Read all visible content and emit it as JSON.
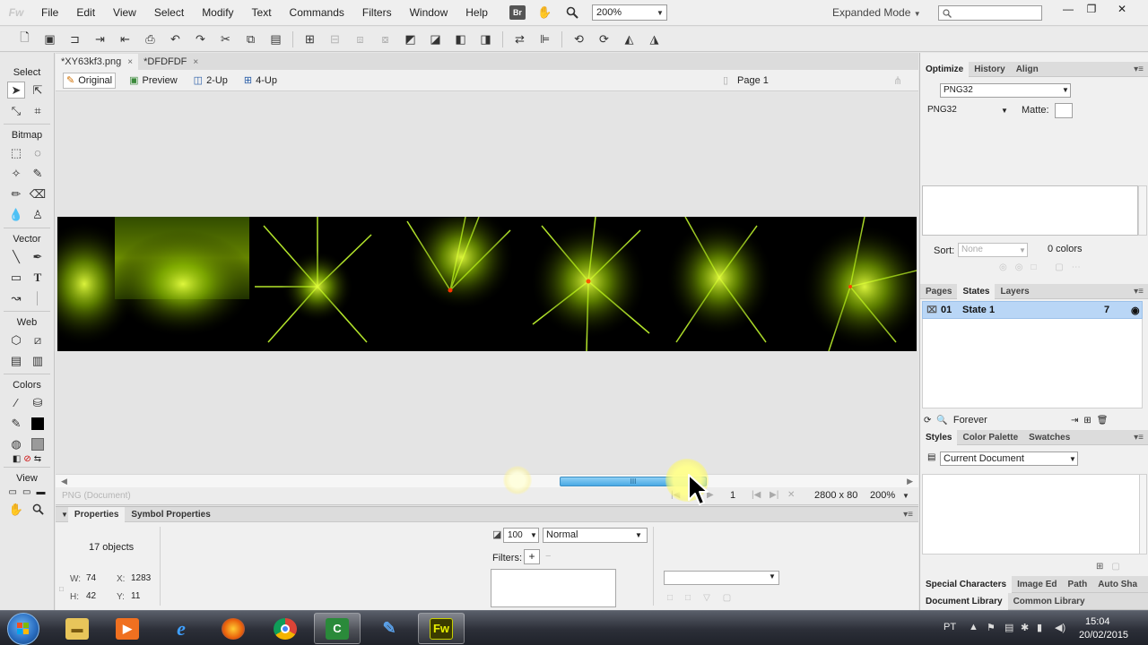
{
  "app": {
    "logo": "Fw",
    "menus": [
      "File",
      "Edit",
      "View",
      "Select",
      "Modify",
      "Text",
      "Commands",
      "Filters",
      "Window",
      "Help"
    ],
    "bridge_badge": "Br",
    "zoom": "200%",
    "mode": "Expanded Mode",
    "search_placeholder": ""
  },
  "tools": {
    "sections": [
      "Select",
      "Bitmap",
      "Vector",
      "Web",
      "Colors",
      "View"
    ]
  },
  "document": {
    "tabs": [
      {
        "label": "*XY63kf3.png",
        "close": "×"
      },
      {
        "label": "*DFDFDF",
        "close": "×"
      }
    ],
    "views": [
      "Original",
      "Preview",
      "2-Up",
      "4-Up"
    ],
    "page": "Page 1",
    "hscroll_grip": "III"
  },
  "status": {
    "doc_type": "PNG (Document)",
    "page_number": "1",
    "size": "2800 x 80",
    "zoom": "200%"
  },
  "properties": {
    "tabs": [
      "Properties",
      "Symbol Properties"
    ],
    "object_count": "17 objects",
    "w_label": "W:",
    "w": "74",
    "h_label": "H:",
    "h": "42",
    "x_label": "X:",
    "x": "1283",
    "y_label": "Y:",
    "y": "11",
    "opacity": "100",
    "blend": "Normal",
    "filters_label": "Filters:",
    "filters_add": "+",
    "filters_remove": "−"
  },
  "optimize": {
    "tabs": [
      "Optimize",
      "History",
      "Align"
    ],
    "preset": "PNG32",
    "format": "PNG32",
    "matte_label": "Matte:",
    "sort_label": "Sort:",
    "sort_value": "None",
    "colors_count": "0 colors"
  },
  "states": {
    "tabs": [
      "Pages",
      "States",
      "Layers"
    ],
    "rows": [
      {
        "index": "01",
        "name": "State 1",
        "frames": "7"
      }
    ],
    "loop": "Forever"
  },
  "styles": {
    "tabs": [
      "Styles",
      "Color Palette",
      "Swatches"
    ],
    "source": "Current Document"
  },
  "bottom_panels": {
    "row1": [
      "Special Characters",
      "Image Ed",
      "Path",
      "Auto Sha"
    ],
    "row2": [
      "Document Library",
      "Common Library"
    ]
  },
  "taskbar": {
    "apps": [
      "explorer",
      "media-player",
      "internet-explorer",
      "firefox",
      "chrome",
      "camtasia",
      "paint",
      "fireworks"
    ],
    "fireworks_label": "Fw",
    "language": "PT",
    "time": "15:04",
    "date": "20/02/2015"
  },
  "colors": {
    "accent_selection": "#b9d6f6",
    "scroll_thumb": "#49a9e4",
    "flare": "#b8f000"
  }
}
